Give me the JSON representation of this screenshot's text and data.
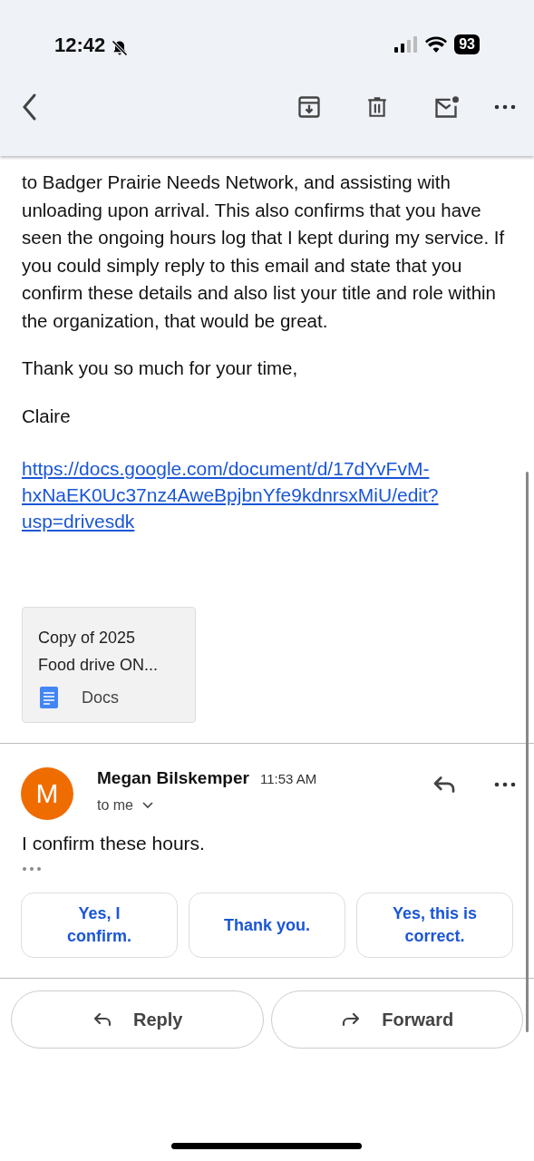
{
  "status_bar": {
    "time": "12:42",
    "battery": "93"
  },
  "message_body": {
    "paragraph": "to Badger Prairie Needs Network, and assisting with unloading upon arrival. This also confirms that you have seen the ongoing hours log that I kept during my service. If you could simply reply to this email and state that you confirm these details and also list your title and role within the organization, that would be great.",
    "closing": "Thank you so much for your time,",
    "signature": "Claire",
    "link": "https://docs.google.com/document/d/17dYvFvM-hxNaEK0Uc37nz4AweBpjbnYfe9kdnrsxMiU/edit?usp=drivesdk",
    "attachment": {
      "title": "Copy of 2025 Food drive ON...",
      "type": "Docs"
    }
  },
  "reply_message": {
    "avatar_letter": "M",
    "sender": "Megan Bilskemper",
    "time": "11:53 AM",
    "recipient": "to me",
    "body": "I confirm these hours."
  },
  "smart_replies": [
    "Yes, I confirm.",
    "Thank you.",
    "Yes, this is correct."
  ],
  "actions": [
    {
      "label": "Reply",
      "kind": "reply"
    },
    {
      "label": "Forward",
      "kind": "forward"
    }
  ]
}
